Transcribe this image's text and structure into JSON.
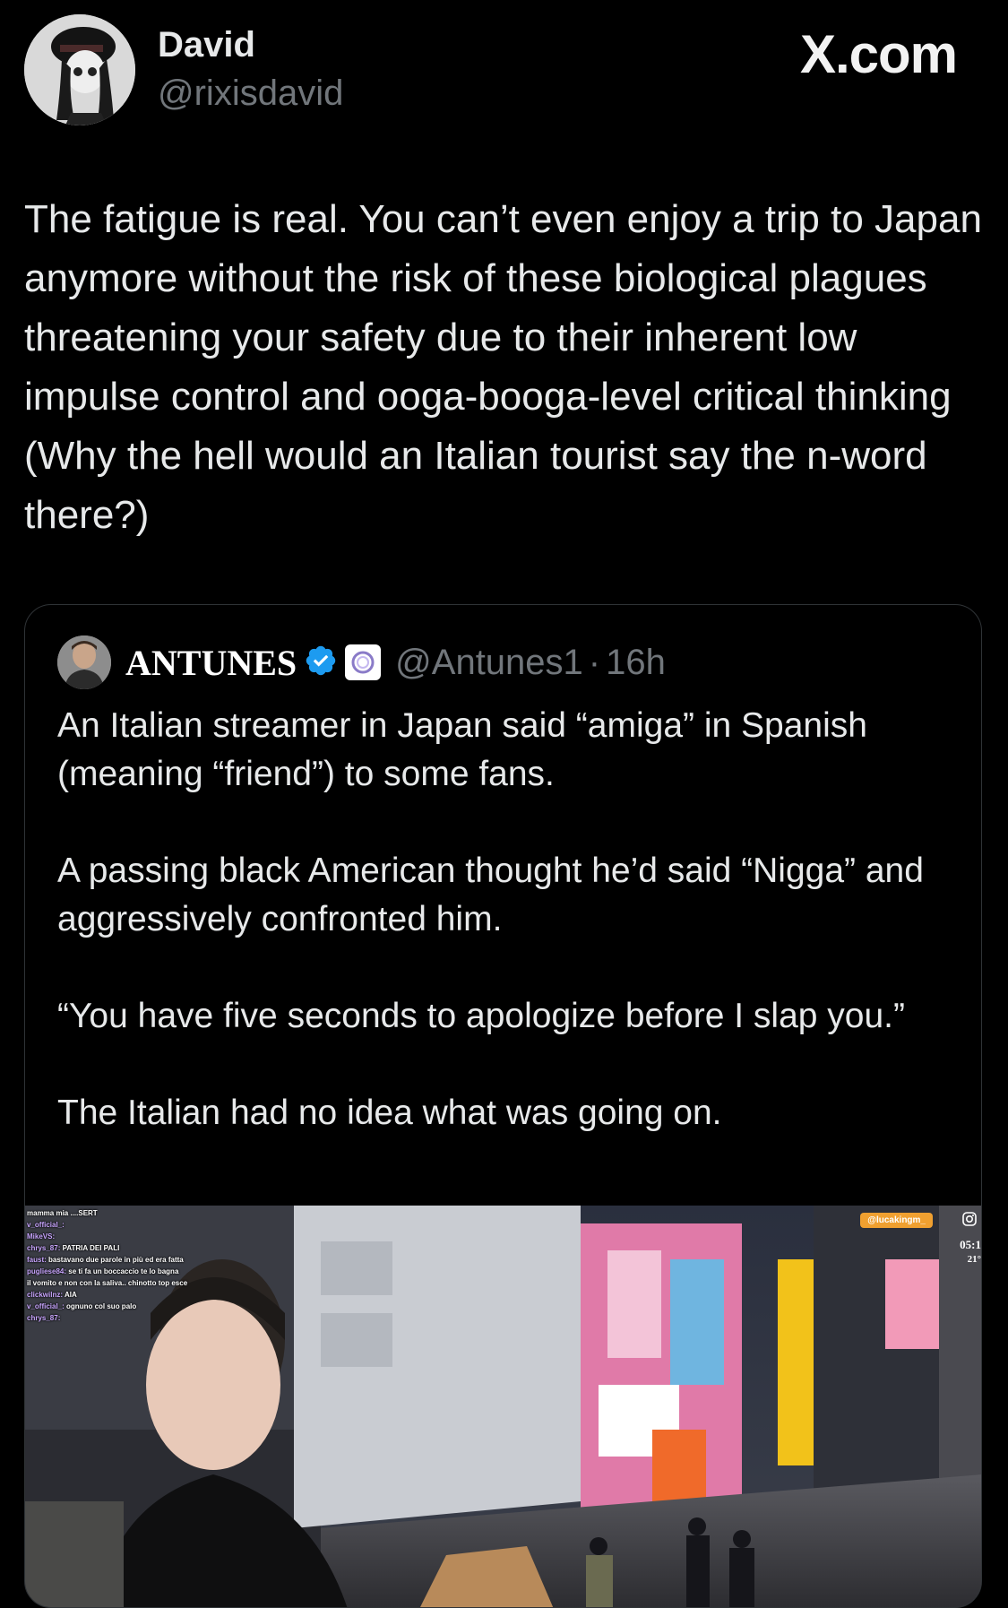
{
  "post": {
    "author_name": "David",
    "author_handle": "@rixisdavid",
    "brand": "X.com",
    "text": "The fatigue is real. You can’t even enjoy a trip to Japan anymore without the risk of these biological plagues threatening your safety due to their inherent low impulse control and ooga-booga-level critical thinking (Why the hell would an Italian tourist say the n-word there?)"
  },
  "quoted": {
    "author_name": "ANTUNES",
    "author_handle": "@Antunes1",
    "separator": "·",
    "time": "16h",
    "paragraphs": [
      "An Italian streamer in Japan said “amiga” in Spanish (meaning “friend”) to some fans.",
      "A passing black American thought he’d said “Nigga” and aggressively confronted him.",
      "“You have five seconds to apologize before I slap you.”",
      "The Italian had no idea what was going on."
    ],
    "media": {
      "chat_lines": [
        {
          "user": "",
          "msg": "mamma mia ....SERT"
        },
        {
          "user": "",
          "msg": ""
        },
        {
          "user": "v_official_:",
          "msg": ""
        },
        {
          "user": "MikeVS:",
          "msg": ""
        },
        {
          "user": "chrys_87:",
          "msg": "PATRIA DEI PALI"
        },
        {
          "user": "faust:",
          "msg": "bastavano due parole in più ed era fatta"
        },
        {
          "user": "pugliese84:",
          "msg": "se ti fa un boccaccio te lo bagna"
        },
        {
          "user": "",
          "msg": "il vomito e non con la saliva.. chinotto top esce"
        },
        {
          "user": "clickwilnz:",
          "msg": "AIA"
        },
        {
          "user": "v_official_:",
          "msg": "ognuno col suo palo"
        },
        {
          "user": "chrys_87:",
          "msg": ""
        }
      ],
      "ig_handle": "@lucakingm_",
      "time": "05:1",
      "temp": "21°"
    }
  },
  "colors": {
    "background": "#000000",
    "text": "#e7e9ea",
    "muted": "#71767b",
    "border": "#2f3336",
    "verified": "#1d9bf0"
  },
  "icons": {
    "verified": "verified-badge-icon",
    "org": "org-affiliate-badge-icon",
    "instagram": "instagram-icon"
  }
}
